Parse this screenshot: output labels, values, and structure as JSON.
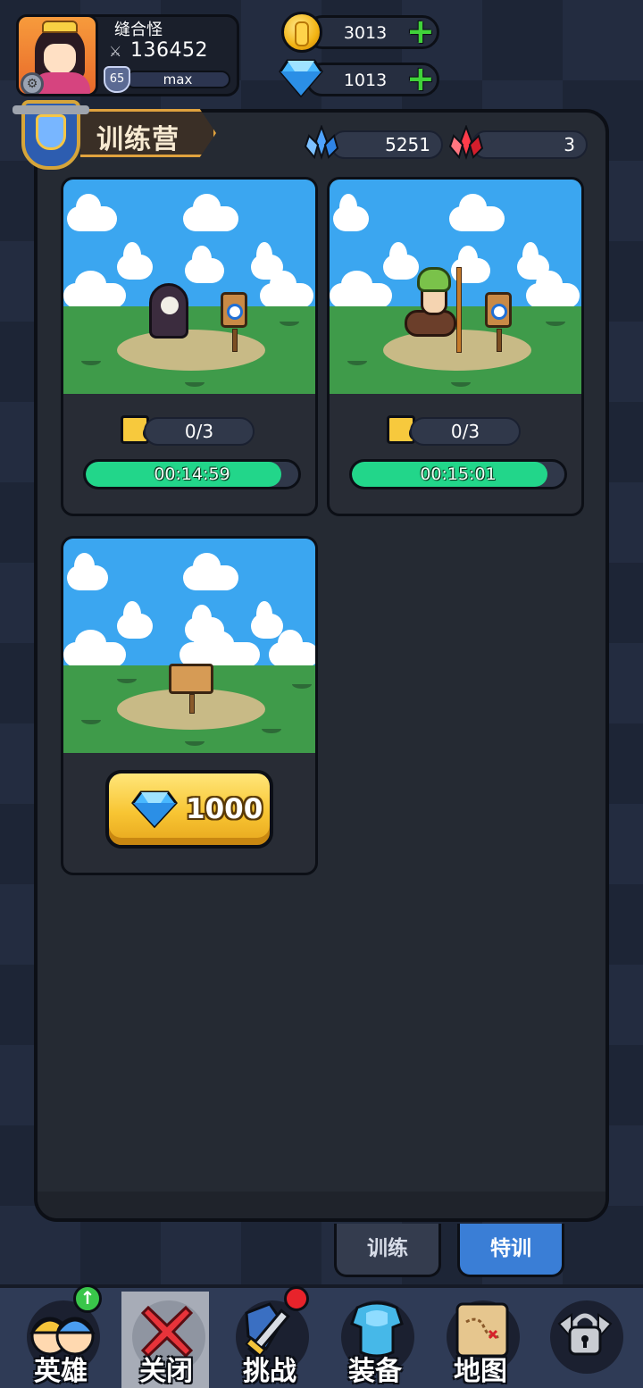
{
  "player": {
    "name": "缝合怪",
    "power": "136452",
    "level": "65",
    "level_status": "max"
  },
  "resources": {
    "gold": "3013",
    "gems": "1013"
  },
  "camp": {
    "title": "训练营",
    "blue_crystal": "5251",
    "red_crystal": "3"
  },
  "slots": [
    {
      "shards": "0/3",
      "timer": "00:14:59",
      "progress": 0.92
    },
    {
      "shards": "0/3",
      "timer": "00:15:01",
      "progress": 0.92
    }
  ],
  "unlock": {
    "price": "1000"
  },
  "tabs": {
    "train": "训练",
    "special": "特训"
  },
  "nav": {
    "heroes": "英雄",
    "close": "关闭",
    "challenge": "挑战",
    "equipment": "装备",
    "map": "地图"
  },
  "colors": {
    "accent_blue": "#3a7ed6",
    "progress_green": "#22d68a",
    "button_gold": "#f8c533"
  }
}
